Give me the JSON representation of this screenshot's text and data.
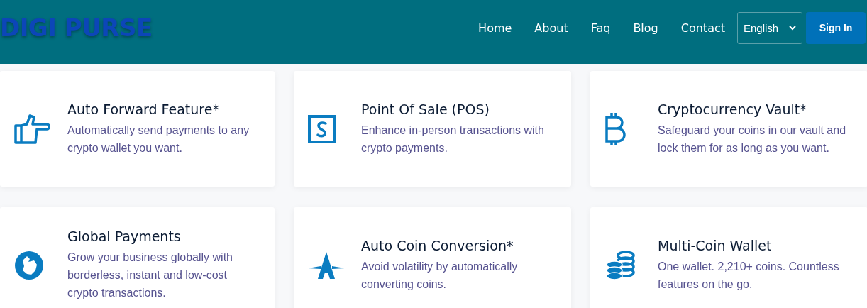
{
  "header": {
    "logo": "DIGI PURSE",
    "nav": [
      {
        "label": "Home"
      },
      {
        "label": "About"
      },
      {
        "label": "Faq"
      },
      {
        "label": "Blog"
      },
      {
        "label": "Contact"
      }
    ],
    "language": {
      "value": "English"
    },
    "sign_in": "Sign In"
  },
  "features": [
    {
      "kind": "hand",
      "title": "Auto Forward Feature*",
      "description": "Automatically send payments to any crypto wallet you want."
    },
    {
      "kind": "pos",
      "title": "Point Of Sale (POS)",
      "description": "Enhance in-person transactions with crypto payments."
    },
    {
      "kind": "bitcoin",
      "title": "Cryptocurrency Vault*",
      "description": "Safeguard your coins in our vault and lock them for as long as you want."
    },
    {
      "kind": "globe",
      "title": "Global Payments",
      "description": "Grow your business globally with borderless, instant and low-cost crypto transactions."
    },
    {
      "kind": "convert",
      "title": "Auto Coin Conversion*",
      "description": "Avoid volatility by automatically converting coins."
    },
    {
      "kind": "coins",
      "title": "Multi-Coin Wallet",
      "description": "One wallet. 2,210+ coins. Countless features on the go."
    }
  ]
}
